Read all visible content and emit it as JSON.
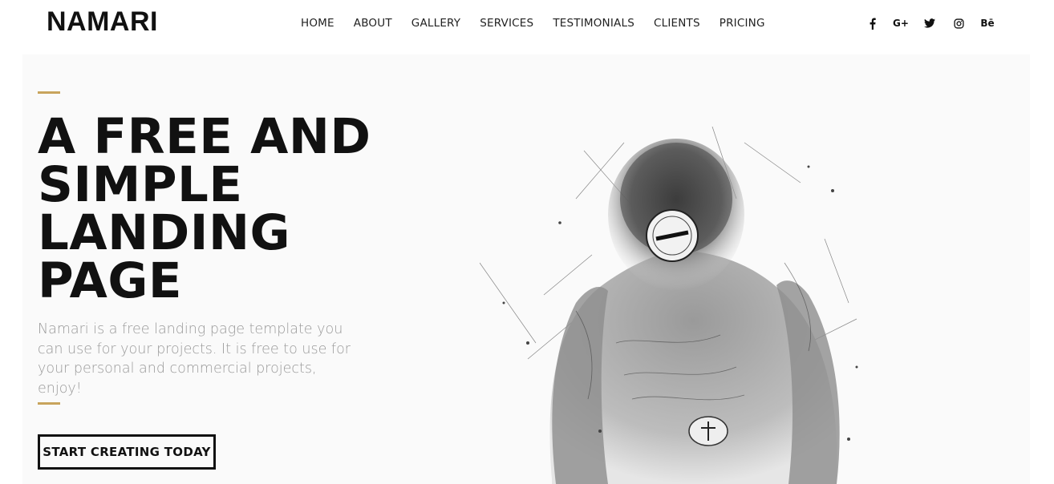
{
  "brand": {
    "logo_text": "NAMARI"
  },
  "nav": {
    "items": [
      {
        "label": "HOME"
      },
      {
        "label": "ABOUT"
      },
      {
        "label": "GALLERY"
      },
      {
        "label": "SERVICES"
      },
      {
        "label": "TESTIMONIALS"
      },
      {
        "label": "CLIENTS"
      },
      {
        "label": "PRICING"
      }
    ]
  },
  "social": [
    {
      "name": "facebook-icon",
      "glyph": "f"
    },
    {
      "name": "google-plus-icon",
      "glyph": "G+"
    },
    {
      "name": "twitter-icon",
      "glyph": "twitter"
    },
    {
      "name": "instagram-icon",
      "glyph": "instagram"
    },
    {
      "name": "behance-icon",
      "glyph": "Bē"
    }
  ],
  "hero": {
    "headline_lines": [
      "A FREE AND",
      "SIMPLE",
      "LANDING",
      "PAGE"
    ],
    "description": "Namari is a free landing page template you can use for your projects. It is free to use for your personal and commercial projects, enjoy!",
    "cta_label": "START CREATING TODAY",
    "image": "tattooed-man-sketch-illustration"
  },
  "colors": {
    "accent": "#c8a45c",
    "text": "#111111",
    "muted": "#9a9a9a",
    "hero_bg": "#fafafa"
  }
}
